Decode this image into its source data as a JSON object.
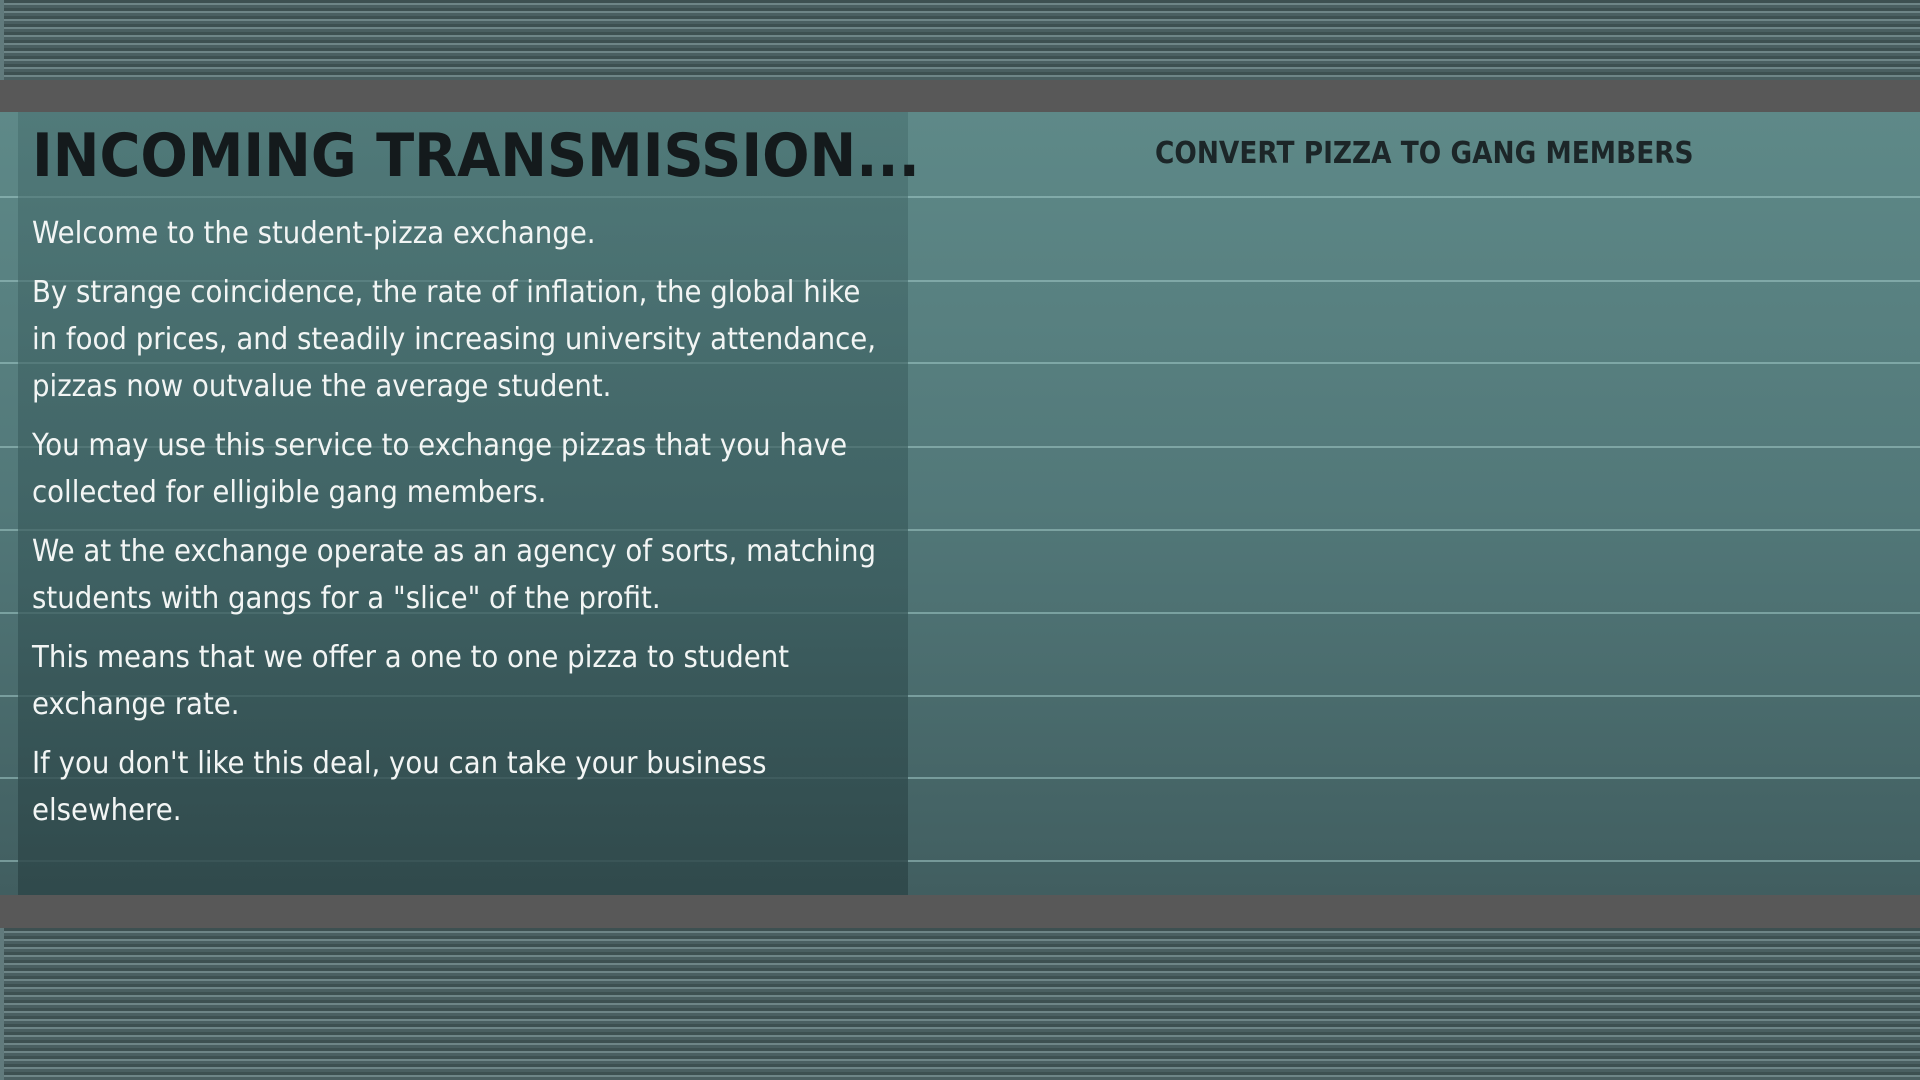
{
  "transmission": {
    "title": "INCOMING TRANSMISSION...",
    "paragraphs": [
      "Welcome to the student-pizza exchange.",
      "By strange coincidence, the rate of inflation, the global hike in food prices, and steadily increasing university attendance, pizzas now outvalue the average student.",
      "You may use this service to exchange pizzas that you have collected for elligible gang members.",
      "We at the exchange operate as an agency of sorts, matching students with gangs for a \"slice\" of the profit.",
      "This means that we offer a one to one pizza to student exchange rate.",
      "If you don't like this deal, you can take your business elsewhere."
    ]
  },
  "exchange": {
    "heading": "CONVERT PIZZA TO GANG MEMBERS"
  },
  "colors": {
    "panel_text": "#f2f5f4",
    "title_text": "#141a1c",
    "heading_text": "#1c2628",
    "gray_bar": "#585858"
  }
}
